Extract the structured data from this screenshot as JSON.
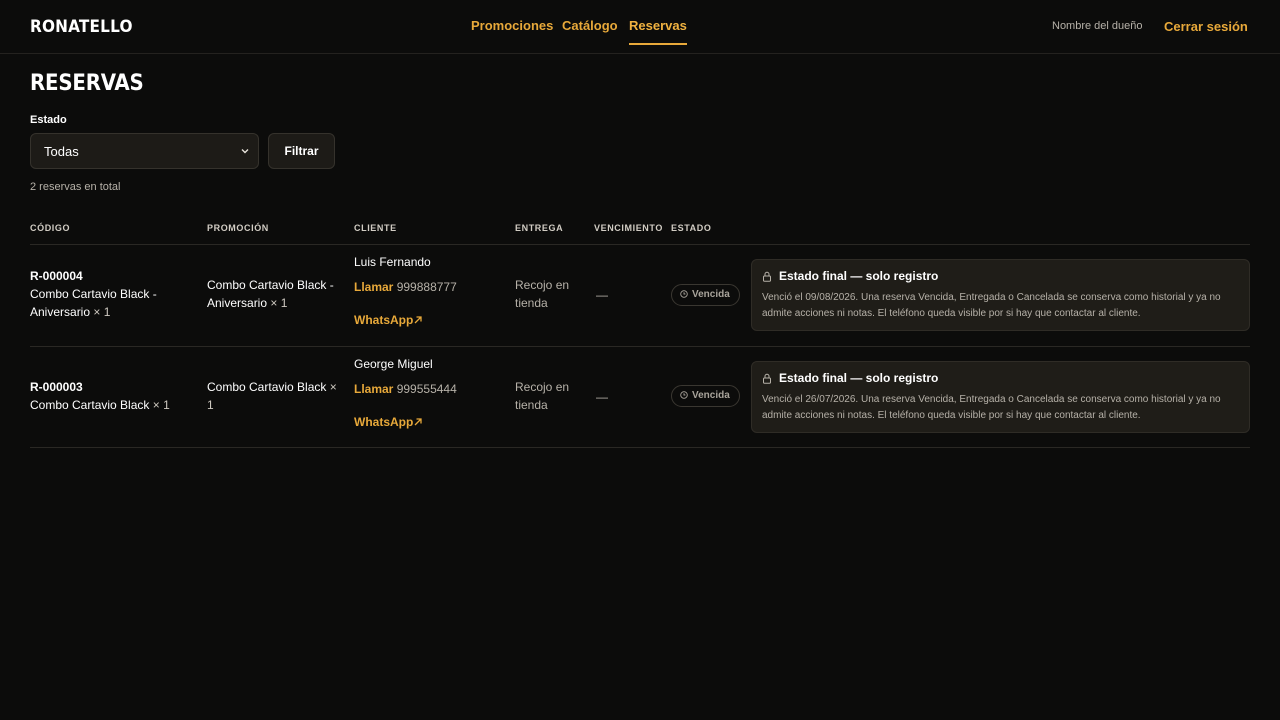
{
  "brand": "RONATELLO",
  "nav": {
    "items": [
      {
        "label": "Promociones"
      },
      {
        "label": "Catálogo"
      },
      {
        "label": "Reservas"
      }
    ],
    "owner_name": "Nombre del dueño",
    "logout_label": "Cerrar sesión"
  },
  "page": {
    "title": "RESERVAS",
    "filter_label": "Estado",
    "filter_value": "Todas",
    "filter_button": "Filtrar",
    "total_text": "2 reservas en total"
  },
  "table": {
    "headers": [
      "CÓDIGO",
      "PROMOCIÓN",
      "CLIENTE",
      "ENTREGA",
      "VENCIMIENTO",
      "ESTADO"
    ],
    "call_label": "Llamar",
    "whatsapp_label": "WhatsApp",
    "rows": [
      {
        "code": "R-000004",
        "product": "Combo Cartavio Black - Aniversario",
        "product_qty": "× 1",
        "promotion": "Combo Cartavio Black - Aniversario",
        "promotion_qty": "× 1",
        "client": "Luis Fernando",
        "phone": "999888777",
        "delivery": "Recojo en tienda",
        "expiry": "—",
        "status": "Vencida",
        "note_title": "Estado final — solo registro",
        "note_text": "Venció el 09/08/2026. Una reserva Vencida, Entregada o Cancelada se conserva como historial y ya no admite acciones ni notas. El teléfono queda visible por si hay que contactar al cliente."
      },
      {
        "code": "R-000003",
        "product": "Combo Cartavio Black",
        "product_qty": "× 1",
        "promotion": "Combo Cartavio Black",
        "promotion_qty": "× 1",
        "client": "George Miguel",
        "phone": "999555444",
        "delivery": "Recojo en tienda",
        "expiry": "—",
        "status": "Vencida",
        "note_title": "Estado final — solo registro",
        "note_text": "Venció el 26/07/2026. Una reserva Vencida, Entregada o Cancelada se conserva como historial y ya no admite acciones ni notas. El teléfono queda visible por si hay que contactar al cliente."
      }
    ]
  },
  "colors": {
    "background": "#0c0c0b",
    "accent": "#e8a93a",
    "panel": "#1f1d18",
    "text": "#ffffff",
    "muted": "#b6b1a8"
  }
}
